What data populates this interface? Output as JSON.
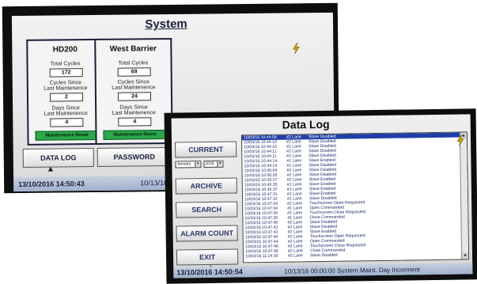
{
  "system_screen": {
    "title": "System",
    "panels": [
      {
        "name": "HD200",
        "total_cycles_label": "Total Cycles",
        "total_cycles": "172",
        "cycles_since_label_1": "Cycles Since",
        "cycles_since_label_2": "Last Maintenence",
        "cycles_since": "2",
        "days_since_label_1": "Days Since",
        "days_since_label_2": "Last Maintenence",
        "days_since": "4",
        "reset_label": "Maintenance Reset"
      },
      {
        "name": "West Barrier",
        "total_cycles_label": "Total Cycles",
        "total_cycles": "69",
        "cycles_since_label_1": "Cycles Since",
        "cycles_since_label_2": "Last Maintenence",
        "cycles_since": "24",
        "days_since_label_1": "Days Since",
        "days_since_label_2": "Last Maintenence",
        "days_since": "4",
        "reset_label": "Maintenance Reset"
      }
    ],
    "buttons": {
      "data_log": "DATA LOG",
      "password": "PASSWORD"
    },
    "status": {
      "time": "13/10/2016 14:50:43",
      "date": "10/13/16"
    },
    "colors": {
      "reset_green": "#2aa84a",
      "title_navy": "#1a1f3a"
    }
  },
  "data_log_screen": {
    "title": "Data Log",
    "buttons": {
      "current": "CURRENT",
      "archive": "ARCHIVE",
      "search": "SEARCH",
      "alarm_count": "ALARM COUNT",
      "exit": "EXIT"
    },
    "month_select": "January",
    "year_select": "2016",
    "log": [
      {
        "ts": "10/03/16 10:44:09",
        "src": "#2 Lane",
        "msg": "Slave Disabled"
      },
      {
        "ts": "10/03/16 10:44:10",
        "src": "#2 Lane",
        "msg": "Slave Disabled"
      },
      {
        "ts": "10/03/16 10:44:10",
        "src": "#1 Lane",
        "msg": "Slave Disabled"
      },
      {
        "ts": "10/03/16 10:44:11",
        "src": "#2 Lane",
        "msg": "Slave Disabled"
      },
      {
        "ts": "10/03/16 10:44:11",
        "src": "#2 Lane",
        "msg": "Slave Disabled"
      },
      {
        "ts": "10/03/16 10:44:14",
        "src": "#1 Lane",
        "msg": "Slave Enabled"
      },
      {
        "ts": "10/03/16 10:44:14",
        "src": "#1 Lane",
        "msg": "Slave Disabled"
      },
      {
        "ts": "10/03/16 10:45:04",
        "src": "#2 Lane",
        "msg": "Slave Disabled"
      },
      {
        "ts": "10/03/16 10:45:05",
        "src": "#2 Lane",
        "msg": "Slave Disabled"
      },
      {
        "ts": "10/03/16 10:45:27",
        "src": "#2 Lane",
        "msg": "Slave Enabled"
      },
      {
        "ts": "10/03/16 10:45:35",
        "src": "#1 Lane",
        "msg": "Slave Enabled"
      },
      {
        "ts": "10/03/16 10:45:37",
        "src": "#1 Lane",
        "msg": "Slave Enabled"
      },
      {
        "ts": "10/03/16 10:47:31",
        "src": "#1 Lane",
        "msg": "Slave Enabled"
      },
      {
        "ts": "10/03/16 10:47:32",
        "src": "#1 Lane",
        "msg": "Slave Disabled"
      },
      {
        "ts": "10/03/16 10:47:34",
        "src": "#2 Lane",
        "msg": "Touchscreen Open Requested"
      },
      {
        "ts": "10/03/16 10:47:34",
        "src": "#1 Lane",
        "msg": "Open Commanded"
      },
      {
        "ts": "10/03/16 10:47:35",
        "src": "#1 Lane",
        "msg": "Touchscreen Close Requested"
      },
      {
        "ts": "10/03/16 10:47:35",
        "src": "#1 Lane",
        "msg": "Close Commanded"
      },
      {
        "ts": "10/03/16 10:47:40",
        "src": "#2 Lane",
        "msg": "Slave Disabled"
      },
      {
        "ts": "10/03/16 10:47:42",
        "src": "#2 Lane",
        "msg": "Slave Disabled"
      },
      {
        "ts": "10/03/16 10:47:42",
        "src": "#2 Lane",
        "msg": "Slave Enabled"
      },
      {
        "ts": "10/03/16 10:47:44",
        "src": "#2 Lane",
        "msg": "Touchscreen Open Requested"
      },
      {
        "ts": "10/03/16 10:47:44",
        "src": "#2 Lane",
        "msg": "Open Commanded"
      },
      {
        "ts": "10/03/16 10:47:46",
        "src": "#2 Lane",
        "msg": "Touchscreen Close Requested"
      },
      {
        "ts": "10/03/16 10:47:46",
        "src": "#2 Lane",
        "msg": "Close Commanded"
      },
      {
        "ts": "10/03/16 11:14:30",
        "src": "#2 Lane",
        "msg": "Slave Disabled"
      }
    ],
    "status": {
      "time": "13/10/2016 14:50:54",
      "event": "10/13/16 00:00:00  System    Maint. Day Increment"
    },
    "colors": {
      "selected_row": "#1f3ea8",
      "log_text": "#1b2a6a"
    }
  },
  "icons": {
    "bolt": "lightning-bolt-icon",
    "cursor": "pointer-cursor-icon",
    "dropdown": "chevron-down-icon"
  }
}
